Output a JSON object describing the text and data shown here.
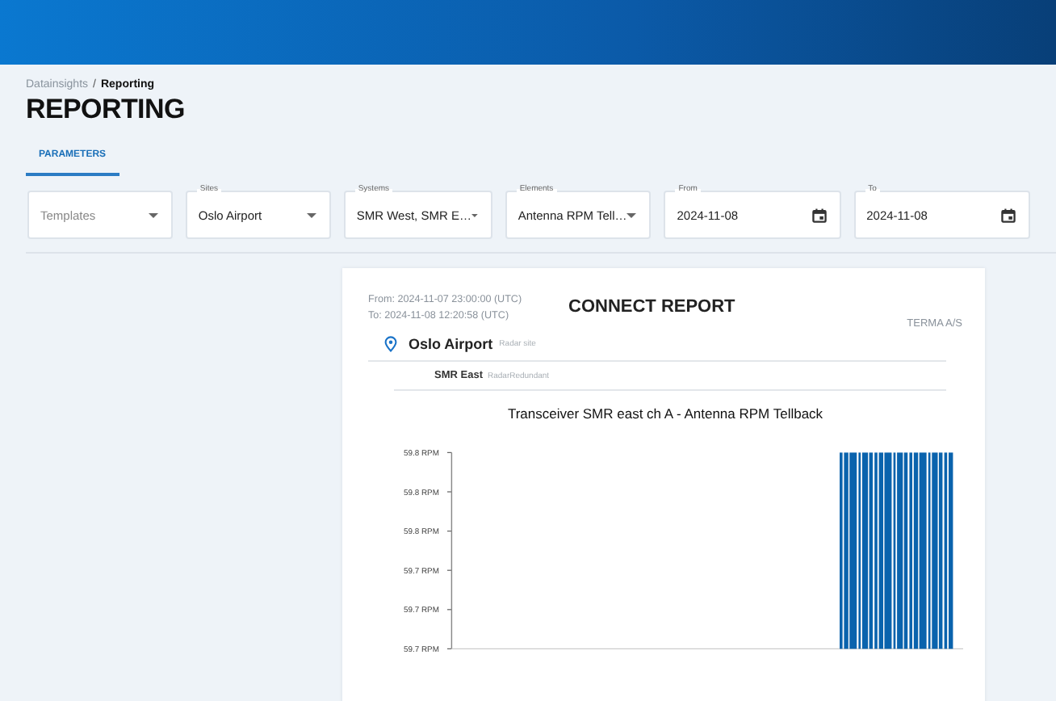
{
  "breadcrumb": {
    "parent": "Datainsights",
    "separator": "/",
    "current": "Reporting"
  },
  "title": "REPORTING",
  "tabs": [
    {
      "label": "PARAMETERS",
      "selected": true
    }
  ],
  "fields": [
    {
      "kind": "select",
      "placeholder": "Templates"
    },
    {
      "kind": "select",
      "label": "Sites",
      "value": "Oslo Airport"
    },
    {
      "kind": "select",
      "label": "Systems",
      "value": "SMR West, SMR E…"
    },
    {
      "kind": "select",
      "label": "Elements",
      "value": "Antenna RPM Tell…"
    },
    {
      "kind": "date",
      "label": "From",
      "value": "2024-11-08"
    },
    {
      "kind": "date",
      "label": "To",
      "value": "2024-11-08"
    }
  ],
  "report": {
    "from": "From: 2024-11-07 23:00:00 (UTC)",
    "to": "To: 2024-11-08 12:20:58 (UTC)",
    "title": "CONNECT REPORT",
    "company": "TERMA A/S",
    "site": {
      "name": "Oslo Airport",
      "type": "Radar site"
    },
    "system": {
      "name": "SMR East",
      "type": "RadarRedundant"
    },
    "chart": {
      "title": "Transceiver SMR east ch A - Antenna RPM Tellback",
      "y_tick_labels": [
        "59.8 RPM",
        "59.8 RPM",
        "59.8 RPM",
        "59.7 RPM",
        "59.7 RPM",
        "59.7 RPM"
      ]
    }
  }
}
